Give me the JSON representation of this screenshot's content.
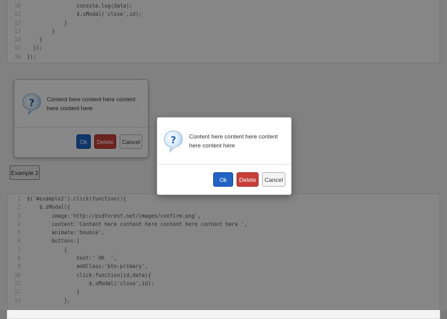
{
  "top_code": [
    {
      "n": "10",
      "text": "                console.log(data);"
    },
    {
      "n": "11",
      "text": "                $.sModal('close',id);"
    },
    {
      "n": "12",
      "text": "            }"
    },
    {
      "n": "13",
      "text": "        }"
    },
    {
      "n": "14",
      "text": "    }"
    },
    {
      "n": "15",
      "text": "  });"
    },
    {
      "n": "16",
      "text": "});"
    }
  ],
  "bottom_code": [
    {
      "n": "1",
      "text": "$('#example2').click(function(){"
    },
    {
      "n": "2",
      "text": "    $.sModal({"
    },
    {
      "n": "3",
      "text": "        image:'http://psdforest.net/images/confirm.png',"
    },
    {
      "n": "4",
      "text": "        content:'Content here content here content here content here ',"
    },
    {
      "n": "5",
      "text": "        animate:'bounce',"
    },
    {
      "n": "6",
      "text": "        buttons:["
    },
    {
      "n": "7",
      "text": "            {"
    },
    {
      "n": "8",
      "text": "                text:' OK  ',"
    },
    {
      "n": "9",
      "text": "                addClass:'btn-primary',"
    },
    {
      "n": "10",
      "text": "                click:function(id,data){"
    },
    {
      "n": "11",
      "text": "                    $.sModal('close',id);"
    },
    {
      "n": "12",
      "text": "                }"
    },
    {
      "n": "13",
      "text": "            },"
    }
  ],
  "background_modal": {
    "content": "Content here content here content here content here",
    "ok_label": "Ok",
    "delete_label": "Delete",
    "cancel_label": "Cancel"
  },
  "example2_label": "Example 2",
  "modal": {
    "content": "Content here content here content here content here",
    "ok_label": "Ok",
    "delete_label": "Delete",
    "cancel_label": "Cancel",
    "icon": "question-icon"
  },
  "colors": {
    "primary": "#1f63c4",
    "danger": "#c9403b",
    "overlay": "rgba(0,0,0,0.45)"
  }
}
